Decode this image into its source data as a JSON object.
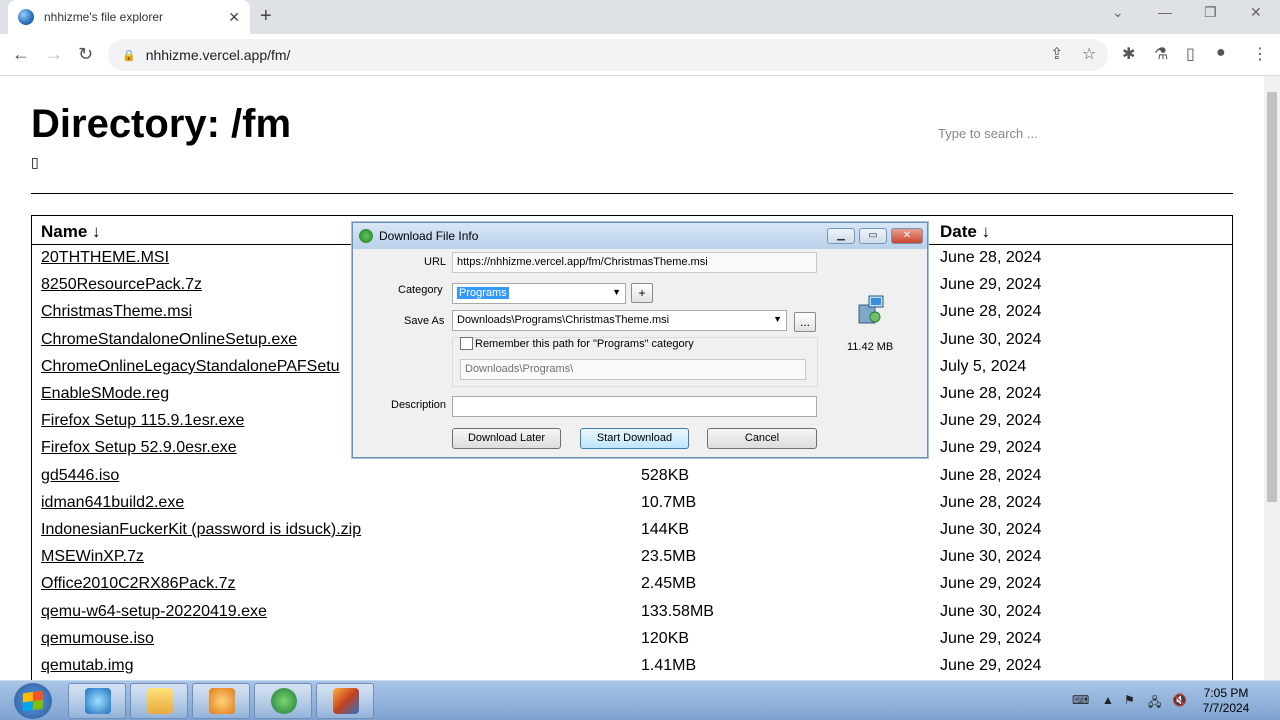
{
  "browser": {
    "tab_title": "nhhizme's file explorer",
    "tab_close": "✕",
    "new_tab": "+",
    "address": "nhhizme.vercel.app/fm/"
  },
  "page": {
    "title": "Directory: /fm",
    "glyph": "▯",
    "search_placeholder": "Type to search ...",
    "headers": {
      "name": "Name ↓",
      "date": "Date ↓"
    },
    "rows": [
      {
        "name": "20THTHEME.MSI",
        "size": "",
        "date": "June 28, 2024"
      },
      {
        "name": "8250ResourcePack.7z",
        "size": "",
        "date": "June 29, 2024"
      },
      {
        "name": "ChristmasTheme.msi",
        "size": "",
        "date": "June 28, 2024"
      },
      {
        "name": "ChromeStandaloneOnlineSetup.exe",
        "size": "",
        "date": "June 30, 2024"
      },
      {
        "name": "ChromeOnlineLegacyStandalonePAFSetu",
        "size": "",
        "date": "July 5, 2024"
      },
      {
        "name": "EnableSMode.reg",
        "size": "",
        "date": "June 28, 2024"
      },
      {
        "name": "Firefox Setup 115.9.1esr.exe",
        "size": "",
        "date": "June 29, 2024"
      },
      {
        "name": "Firefox Setup 52.9.0esr.exe",
        "size": "",
        "date": "June 29, 2024"
      },
      {
        "name": "gd5446.iso",
        "size": "528KB",
        "date": "June 28, 2024"
      },
      {
        "name": "idman641build2.exe",
        "size": "10.7MB",
        "date": "June 28, 2024"
      },
      {
        "name": "IndonesianFuckerKit (password is idsuck).zip",
        "size": "144KB",
        "date": "June 30, 2024"
      },
      {
        "name": "MSEWinXP.7z",
        "size": "23.5MB",
        "date": "June 30, 2024"
      },
      {
        "name": "Office2010C2RX86Pack.7z",
        "size": "2.45MB",
        "date": "June 29, 2024"
      },
      {
        "name": "qemu-w64-setup-20220419.exe",
        "size": "133.58MB",
        "date": "June 30, 2024"
      },
      {
        "name": "qemumouse.iso",
        "size": "120KB",
        "date": "June 29, 2024"
      },
      {
        "name": "qemutab.img",
        "size": "1.41MB",
        "date": "June 29, 2024"
      }
    ]
  },
  "dialog": {
    "title": "Download File Info",
    "url_label": "URL",
    "url_value": "https://nhhizme.vercel.app/fm/ChristmasTheme.msi",
    "category_label": "Category",
    "category_value": "Programs",
    "add_label": "+",
    "saveas_label": "Save As",
    "saveas_value": "Downloads\\Programs\\ChristmasTheme.msi",
    "browse_label": "...",
    "remember_label": "Remember this path for \"Programs\" category",
    "remember_checked": false,
    "path_value": "Downloads\\Programs\\",
    "description_label": "Description",
    "description_value": "",
    "file_size": "11.42  MB",
    "btn_later": "Download Later",
    "btn_start": "Start Download",
    "btn_cancel": "Cancel"
  },
  "taskbar": {
    "time": "7:05 PM",
    "date": "7/7/2024"
  }
}
